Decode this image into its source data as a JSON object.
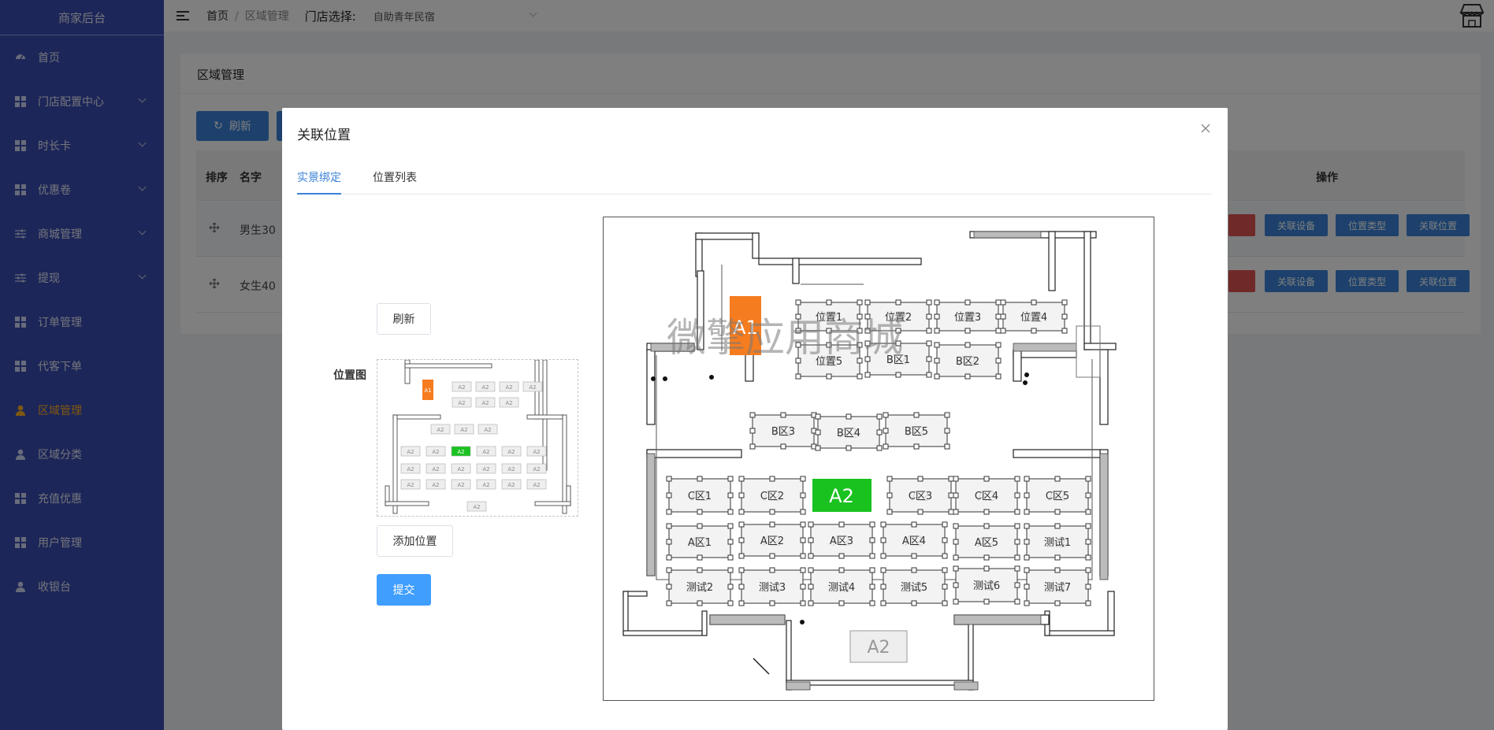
{
  "sidebar": {
    "brand": "商家后台",
    "items": [
      {
        "label": "首页",
        "icon": "dashboard-icon",
        "chevron": false
      },
      {
        "label": "门店配置中心",
        "icon": "grid-icon",
        "chevron": true
      },
      {
        "label": "时长卡",
        "icon": "grid-icon",
        "chevron": true
      },
      {
        "label": "优惠卷",
        "icon": "grid-icon",
        "chevron": true
      },
      {
        "label": "商城管理",
        "icon": "sliders-icon",
        "chevron": true
      },
      {
        "label": "提现",
        "icon": "sliders-icon",
        "chevron": true
      },
      {
        "label": "订单管理",
        "icon": "grid-icon",
        "chevron": false
      },
      {
        "label": "代客下单",
        "icon": "grid-icon",
        "chevron": false
      },
      {
        "label": "区域管理",
        "icon": "user-icon",
        "chevron": false,
        "active": true
      },
      {
        "label": "区域分类",
        "icon": "user-icon",
        "chevron": false
      },
      {
        "label": "充值优惠",
        "icon": "grid-icon",
        "chevron": false
      },
      {
        "label": "用户管理",
        "icon": "grid-icon",
        "chevron": false
      },
      {
        "label": "收银台",
        "icon": "user-icon",
        "chevron": false
      }
    ],
    "bg_color": "#3a4cb1",
    "active_color": "#ffb020"
  },
  "topbar": {
    "breadcrumb_home": "首页",
    "breadcrumb_sep": "/",
    "breadcrumb_current": "区域管理",
    "store_label": "门店选择:",
    "store_value": "自助青年民宿"
  },
  "page": {
    "title": "区域管理",
    "refresh_label": "刷新",
    "table": {
      "headers": {
        "sort": "排序",
        "name": "名字",
        "actions": "操作"
      },
      "rows": [
        {
          "name": "男生30"
        },
        {
          "name": "女生40"
        }
      ],
      "row_actions": [
        "关联设备",
        "位置类型",
        "关联位置"
      ]
    }
  },
  "modal": {
    "title": "关联位置",
    "tabs": [
      "实景绑定",
      "位置列表"
    ],
    "active_tab": 0,
    "refresh_label": "刷新",
    "map_label": "位置图",
    "add_label": "添加位置",
    "submit_label": "提交",
    "primary_color": "#409eff"
  },
  "floorplan": {
    "watermark": "微擎应用商城",
    "highlight_orange": "A1",
    "highlight_green": "A2",
    "bottom_label": "A2",
    "row1": [
      "位置1",
      "位置2",
      "位置3",
      "位置4"
    ],
    "row2": [
      "位置5",
      "B区1",
      "B区2"
    ],
    "row3": [
      "B区3",
      "B区4",
      "B区5"
    ],
    "row4": [
      "C区1",
      "C区2",
      "C区3",
      "C区4",
      "C区5"
    ],
    "row5": [
      "A区1",
      "A区2",
      "A区3",
      "A区4",
      "A区5",
      "测试1"
    ],
    "row6": [
      "测试2",
      "测试3",
      "测试4",
      "测试5",
      "测试6",
      "测试7"
    ],
    "ghost": "A2"
  },
  "thumbnail": {
    "orange": "A1",
    "green": "A2",
    "cell": "A2"
  }
}
